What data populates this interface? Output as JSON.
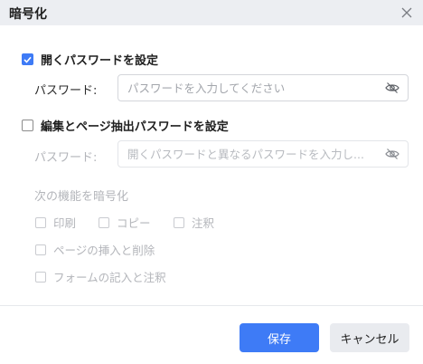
{
  "dialog": {
    "title": "暗号化",
    "close_icon": "close-icon"
  },
  "open_password": {
    "checked": true,
    "label": "開くパスワードを設定",
    "field_label": "パスワード:",
    "placeholder": "パスワードを入力してください",
    "value": ""
  },
  "edit_password": {
    "checked": false,
    "label": "編集とページ抽出パスワードを設定",
    "field_label": "パスワード:",
    "placeholder": "開くパスワードと異なるパスワードを入力し...",
    "value": ""
  },
  "encrypt_section": {
    "label": "次の機能を暗号化",
    "options": [
      {
        "label": "印刷",
        "checked": false
      },
      {
        "label": "コピー",
        "checked": false
      },
      {
        "label": "注釈",
        "checked": false
      },
      {
        "label": "ページの挿入と削除",
        "checked": false
      },
      {
        "label": "フォームの記入と注釈",
        "checked": false
      }
    ]
  },
  "footer": {
    "save_label": "保存",
    "cancel_label": "キャンセル"
  },
  "colors": {
    "accent": "#3e7bf6",
    "titlebar": "#eceef2",
    "disabled_text": "#b3b5ba"
  }
}
